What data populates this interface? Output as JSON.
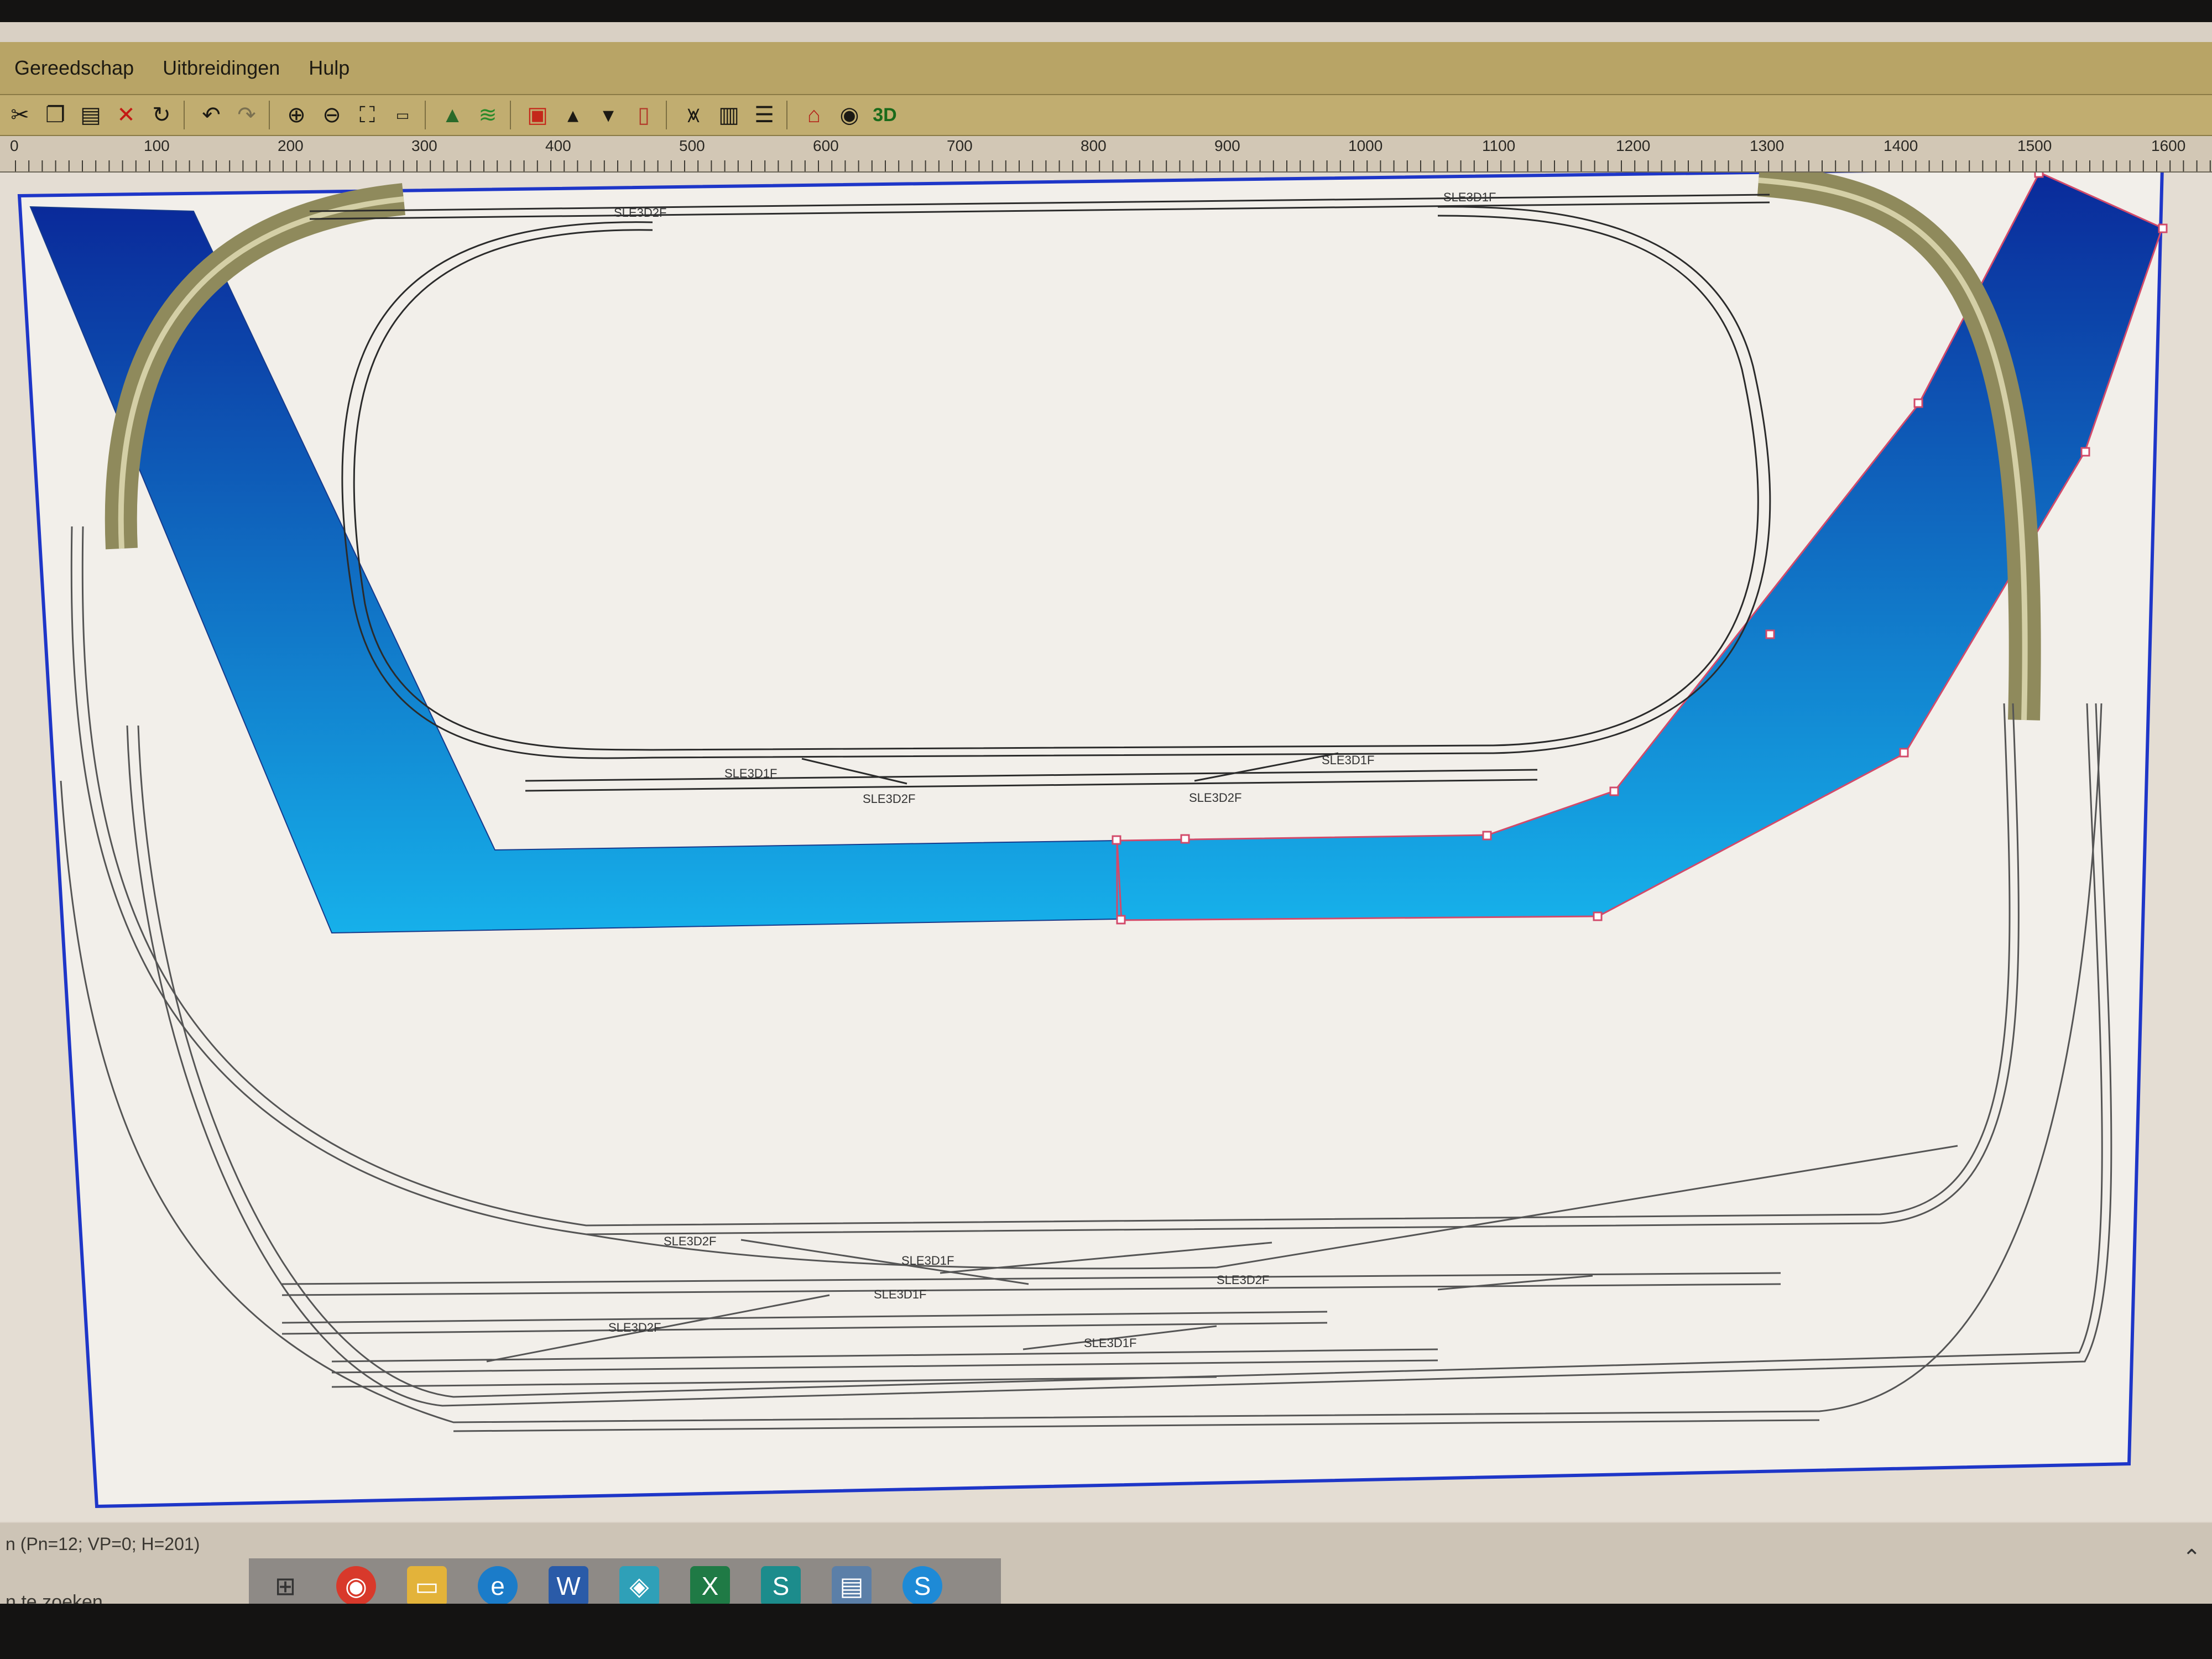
{
  "menu": {
    "items": [
      "Gereedschap",
      "Uitbreidingen",
      "Hulp"
    ]
  },
  "toolbar": {
    "icons": [
      "scissors-icon",
      "copy-icon",
      "paste-icon",
      "delete-icon",
      "rotate-icon",
      "undo-icon",
      "redo-icon",
      "zoom-in-icon",
      "zoom-out-icon",
      "fit-window-icon",
      "scale-icon",
      "landscape-icon",
      "layers-icon",
      "track-height-icon",
      "track-height-up-icon",
      "track-height-down-icon",
      "track-height-off-icon",
      "bridge-icon",
      "component-icon",
      "lines-icon",
      "building-icon",
      "figure-icon",
      "view-3d-icon"
    ],
    "view_3d_label": "3D"
  },
  "ruler": {
    "labels": [
      "0",
      "100",
      "200",
      "300",
      "400",
      "500",
      "600",
      "700",
      "800",
      "900",
      "1000",
      "1100",
      "1200",
      "1300",
      "1400",
      "1500",
      "1600"
    ]
  },
  "track_labels": {
    "top_left": "SLE3D2F",
    "top_right": "SLE3D1F",
    "mid_a": "SLE3D1F",
    "mid_b": "SLE3D2F",
    "mid_c": "SLE3D2F",
    "mid_d": "SLE3D1F",
    "yard_a": "SLE3D2F",
    "yard_b": "SLE3D1F",
    "yard_c": "SLE3D2F",
    "yard_d": "SLE3D1F",
    "yard_e": "SLE3D2F",
    "yard_f": "SLE3D1F"
  },
  "status": {
    "info": "n (Pn=12; VP=0; H=201)",
    "search": "n te zoeken"
  },
  "taskbar": {
    "icons": [
      "task-view-icon",
      "chrome-icon",
      "file-explorer-icon",
      "edge-icon",
      "word-icon",
      "app-icon",
      "excel-icon",
      "sharepoint-icon",
      "document-icon",
      "skype-icon"
    ]
  },
  "colors": {
    "water_dark": "#0a2a9a",
    "water_light": "#12a8e6",
    "ramp": "#8f8a5c",
    "track": "#2b2b2b",
    "border": "#1e36c8"
  }
}
